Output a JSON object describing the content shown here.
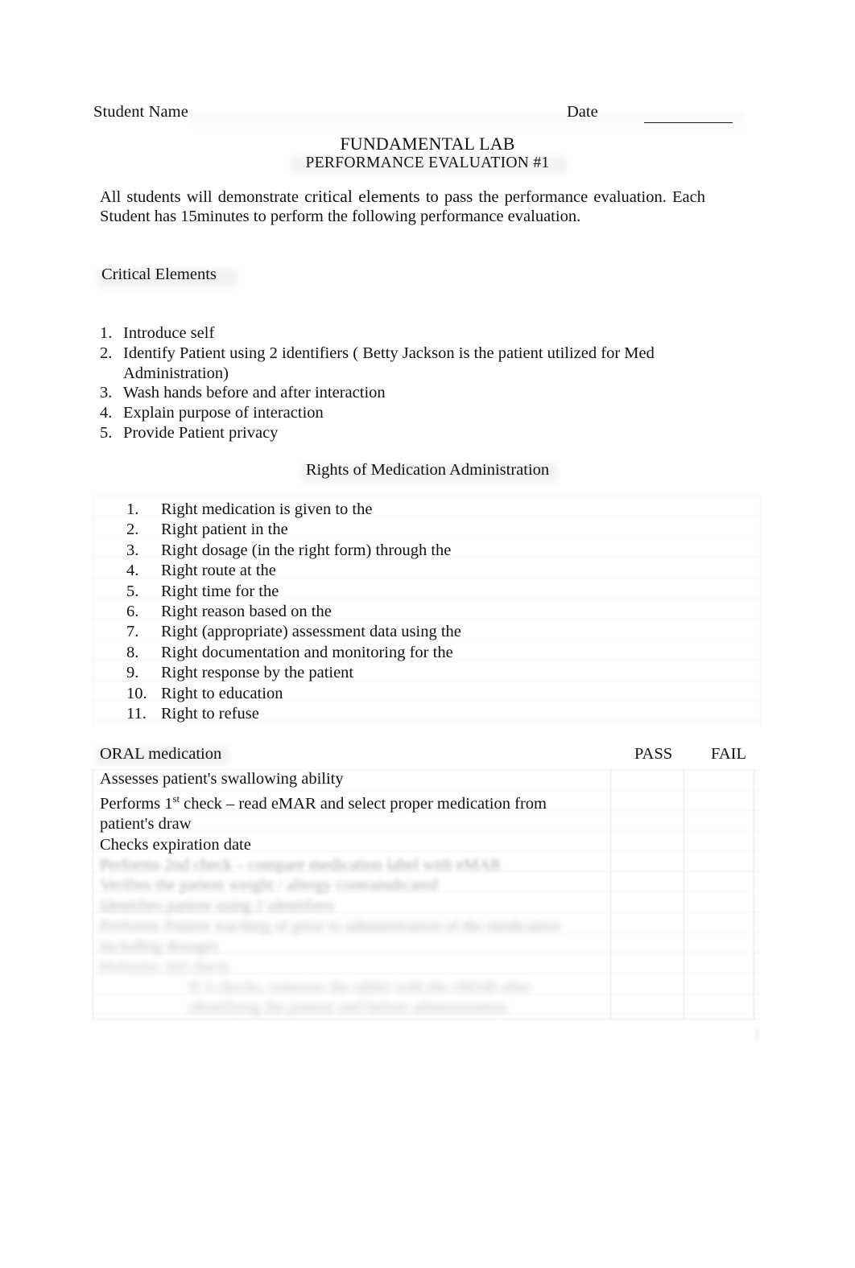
{
  "header": {
    "student_name_label": "Student Name",
    "date_label": "Date"
  },
  "titles": {
    "main": "FUNDAMENTAL LAB",
    "sub": "PERFORMANCE   EVALUATION   #1"
  },
  "intro": {
    "part1": "All students will demonstrate ",
    "emphasis": "critical elements",
    "part2": " to pass the performance evaluation. Each Student has 15minutes  to perform the following performance evaluation."
  },
  "critical_elements": {
    "heading": "Critical Elements",
    "items": [
      {
        "num": "1.",
        "text": "Introduce self"
      },
      {
        "num": "2.",
        "text": "Identify Patient using 2 identifiers ( Betty Jackson is the patient utilized for Med Administration)"
      },
      {
        "num": "3.",
        "text": "Wash hands before and after interaction"
      },
      {
        "num": "4.",
        "text": "Explain purpose of interaction"
      },
      {
        "num": "5.",
        "text": "Provide Patient privacy"
      }
    ]
  },
  "rights": {
    "heading": "Rights of Medication Administration",
    "items": [
      {
        "num": "1.",
        "text": "Right medication   is given to the"
      },
      {
        "num": "2.",
        "text": "Right patient   in the"
      },
      {
        "num": "3.",
        "text": "Right dosage  (in the right form) through the"
      },
      {
        "num": "4.",
        "text": "Right route   at the"
      },
      {
        "num": "5.",
        "text": "Right time  for the"
      },
      {
        "num": "6.",
        "text": "Right reason   based on the"
      },
      {
        "num": "7.",
        "text": "Right (appropriate) assessment    data using the"
      },
      {
        "num": "8.",
        "text": "Right documentation   and monitoring for the"
      },
      {
        "num": "9.",
        "text": "Right response  by the patient"
      },
      {
        "num": "10.",
        "text": "Right to education"
      },
      {
        "num": "11.",
        "text": "Right to refuse"
      }
    ]
  },
  "evaluation_table": {
    "columns": {
      "criteria": "ORAL medication",
      "pass": "PASS",
      "fail": "FAIL"
    },
    "rows": [
      {
        "text": "Assesses patient's swallowing ability",
        "legible": true
      },
      {
        "text_prefix": "Performs 1",
        "text_sup": "st",
        "text_suffix": " check – read eMAR and select proper medication from patient's draw",
        "legible": true
      },
      {
        "text": "Checks expiration date",
        "legible": true
      }
    ],
    "illegible_rows": [
      {
        "text": "Performs 2nd check – compare medication label with eMAR",
        "blur": "f1"
      },
      {
        "text": "Verifies the patient weight / allergy contraindicated",
        "blur": "f2"
      },
      {
        "text": "Identifies patient using 2 identifiers",
        "blur": "f3"
      },
      {
        "text": "Performs Patient teaching of prior to administration of the medication",
        "blur": "f4"
      },
      {
        "text": "including dosages",
        "blur": "f4"
      },
      {
        "text": "Performs 3rd check",
        "blur": "f5"
      },
      {
        "text": "If 3 checks, removes the tablet with the eMAR after",
        "blur": "f5",
        "indented": true
      },
      {
        "text": "identifying the patient and before administration",
        "blur": "f5",
        "indented": true
      }
    ]
  },
  "page_artifact": "1"
}
